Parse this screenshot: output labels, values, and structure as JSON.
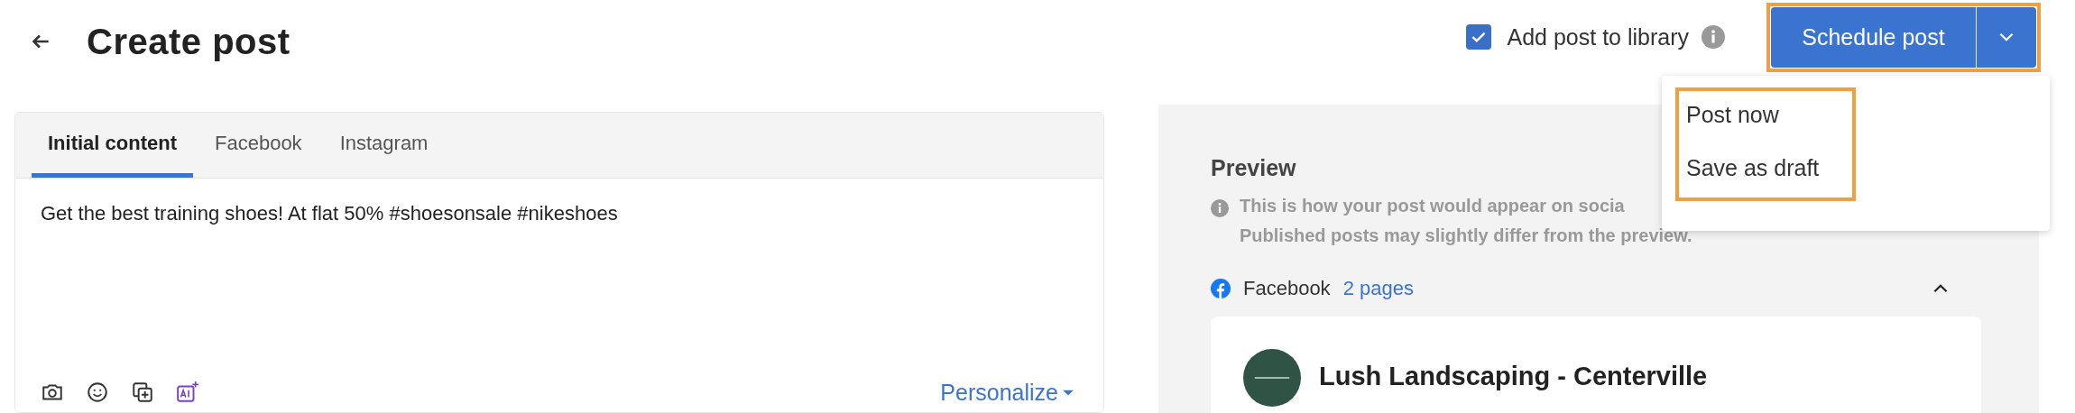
{
  "header": {
    "title": "Create post"
  },
  "library": {
    "label": "Add post to library",
    "checked": true
  },
  "schedule": {
    "label": "Schedule post",
    "highlighted": true
  },
  "menu": {
    "highlighted": true,
    "items": [
      "Post now",
      "Save as draft"
    ]
  },
  "tabs": [
    {
      "label": "Initial content",
      "selected": true
    },
    {
      "label": "Facebook",
      "selected": false
    },
    {
      "label": "Instagram",
      "selected": false
    }
  ],
  "editor": {
    "value": "Get the best training shoes! At flat 50% #shoesonsale #nikeshoes",
    "personalize": "Personalize"
  },
  "preview": {
    "title": "Preview",
    "note": [
      "This is how your post would appear on socia",
      "Published posts may slightly differ from the preview."
    ],
    "network": "Facebook",
    "pages": "2 pages",
    "expanded": true,
    "account": "Lush Landscaping - Centerville"
  }
}
